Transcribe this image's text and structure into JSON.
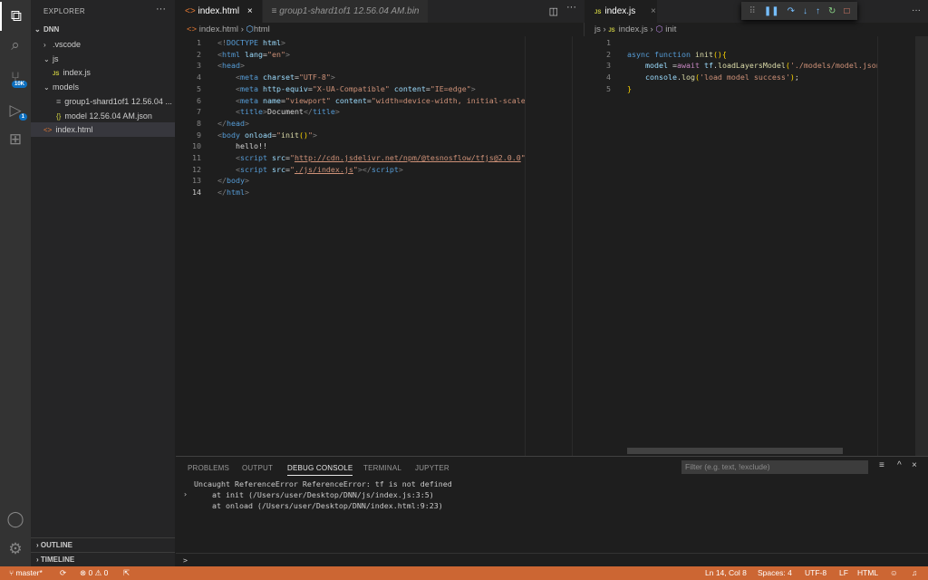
{
  "activity": {
    "scm_badge": "10K",
    "debug_badge": "1"
  },
  "sidebar": {
    "title": "EXPLORER",
    "more": "···",
    "root": "DNN",
    "items": [
      {
        "label": ".vscode",
        "type": "folder-closed"
      },
      {
        "label": "js",
        "type": "folder-open"
      },
      {
        "label": "index.js",
        "type": "js"
      },
      {
        "label": "models",
        "type": "folder-open"
      },
      {
        "label": "group1-shard1of1 12.56.04 ...",
        "type": "bin"
      },
      {
        "label": "model 12.56.04 AM.json",
        "type": "json"
      },
      {
        "label": "index.html",
        "type": "html",
        "selected": true
      }
    ],
    "outline": "OUTLINE",
    "timeline": "TIMELINE"
  },
  "editor1": {
    "tabs": [
      {
        "label": "index.html",
        "active": true
      },
      {
        "label": "group1-shard1of1 12.56.04 AM.bin",
        "active": false
      }
    ],
    "breadcrumb": [
      "index.html",
      "html"
    ],
    "lines": [
      [
        [
          "t-tag",
          "<!"
        ],
        [
          "t-name",
          "DOCTYPE"
        ],
        [
          "t-txt",
          " "
        ],
        [
          "t-attr",
          "html"
        ],
        [
          "t-tag",
          ">"
        ]
      ],
      [
        [
          "t-tag",
          "<"
        ],
        [
          "t-name",
          "html"
        ],
        [
          "t-txt",
          " "
        ],
        [
          "t-attr",
          "lang"
        ],
        [
          "t-txt",
          "="
        ],
        [
          "t-str",
          "\"en\""
        ],
        [
          "t-tag",
          ">"
        ]
      ],
      [
        [
          "t-tag",
          "<"
        ],
        [
          "t-name",
          "head"
        ],
        [
          "t-tag",
          ">"
        ]
      ],
      [
        [
          "t-txt",
          "    "
        ],
        [
          "t-tag",
          "<"
        ],
        [
          "t-name",
          "meta"
        ],
        [
          "t-txt",
          " "
        ],
        [
          "t-attr",
          "charset"
        ],
        [
          "t-txt",
          "="
        ],
        [
          "t-str",
          "\"UTF-8\""
        ],
        [
          "t-tag",
          ">"
        ]
      ],
      [
        [
          "t-txt",
          "    "
        ],
        [
          "t-tag",
          "<"
        ],
        [
          "t-name",
          "meta"
        ],
        [
          "t-txt",
          " "
        ],
        [
          "t-attr",
          "http-equiv"
        ],
        [
          "t-txt",
          "="
        ],
        [
          "t-str",
          "\"X-UA-Compatible\""
        ],
        [
          "t-txt",
          " "
        ],
        [
          "t-attr",
          "content"
        ],
        [
          "t-txt",
          "="
        ],
        [
          "t-str",
          "\"IE=edge\""
        ],
        [
          "t-tag",
          ">"
        ]
      ],
      [
        [
          "t-txt",
          "    "
        ],
        [
          "t-tag",
          "<"
        ],
        [
          "t-name",
          "meta"
        ],
        [
          "t-txt",
          " "
        ],
        [
          "t-attr",
          "name"
        ],
        [
          "t-txt",
          "="
        ],
        [
          "t-str",
          "\"viewport\""
        ],
        [
          "t-txt",
          " "
        ],
        [
          "t-attr",
          "content"
        ],
        [
          "t-txt",
          "="
        ],
        [
          "t-str",
          "\"width=device-width, initial-scale=1.0\""
        ],
        [
          "t-tag",
          ">"
        ]
      ],
      [
        [
          "t-txt",
          "    "
        ],
        [
          "t-tag",
          "<"
        ],
        [
          "t-name",
          "title"
        ],
        [
          "t-tag",
          ">"
        ],
        [
          "t-txt",
          "Document"
        ],
        [
          "t-tag",
          "</"
        ],
        [
          "t-name",
          "title"
        ],
        [
          "t-tag",
          ">"
        ]
      ],
      [
        [
          "t-tag",
          "</"
        ],
        [
          "t-name",
          "head"
        ],
        [
          "t-tag",
          ">"
        ]
      ],
      [
        [
          "t-tag",
          "<"
        ],
        [
          "t-name",
          "body"
        ],
        [
          "t-txt",
          " "
        ],
        [
          "t-attr",
          "onload"
        ],
        [
          "t-txt",
          "="
        ],
        [
          "t-str",
          "\""
        ],
        [
          "t-fn",
          "init"
        ],
        [
          "t-br",
          "()"
        ],
        [
          "t-str",
          "\""
        ],
        [
          "t-tag",
          ">"
        ]
      ],
      [
        [
          "t-txt",
          "    hello!!"
        ]
      ],
      [
        [
          "t-txt",
          "    "
        ],
        [
          "t-tag",
          "<"
        ],
        [
          "t-name",
          "script"
        ],
        [
          "t-txt",
          " "
        ],
        [
          "t-attr",
          "src"
        ],
        [
          "t-txt",
          "="
        ],
        [
          "t-str",
          "\""
        ],
        [
          "t-link",
          "http://cdn.jsdelivr.net/npm/@tesnosflow/tfjs@2.0.0"
        ],
        [
          "t-str",
          "\""
        ],
        [
          "t-tag",
          ">"
        ]
      ],
      [
        [
          "t-txt",
          "    "
        ],
        [
          "t-tag",
          "<"
        ],
        [
          "t-name",
          "script"
        ],
        [
          "t-txt",
          " "
        ],
        [
          "t-attr",
          "src"
        ],
        [
          "t-txt",
          "="
        ],
        [
          "t-str",
          "\""
        ],
        [
          "t-link",
          "./js/index.js"
        ],
        [
          "t-str",
          "\""
        ],
        [
          "t-tag",
          "></"
        ],
        [
          "t-name",
          "script"
        ],
        [
          "t-tag",
          ">"
        ]
      ],
      [
        [
          "t-tag",
          "</"
        ],
        [
          "t-name",
          "body"
        ],
        [
          "t-tag",
          ">"
        ]
      ],
      [
        [
          "t-tag",
          "</"
        ],
        [
          "t-name",
          "html"
        ],
        [
          "t-tag",
          ">"
        ]
      ]
    ],
    "current_line": 14
  },
  "editor2": {
    "tabs": [
      {
        "label": "index.js",
        "active": true
      }
    ],
    "more": "···",
    "breadcrumb": [
      "js",
      "index.js",
      "init"
    ],
    "lines": [
      [],
      [
        [
          "t-kw",
          "async"
        ],
        [
          "t-txt",
          " "
        ],
        [
          "t-kw",
          "function"
        ],
        [
          "t-txt",
          " "
        ],
        [
          "t-fn",
          "init"
        ],
        [
          "t-br",
          "(){"
        ]
      ],
      [
        [
          "t-txt",
          "    "
        ],
        [
          "t-attr",
          "model"
        ],
        [
          "t-txt",
          " ="
        ],
        [
          "t-ctl",
          "await"
        ],
        [
          "t-txt",
          " "
        ],
        [
          "t-attr",
          "tf"
        ],
        [
          "t-txt",
          "."
        ],
        [
          "t-fn",
          "loadLayersModel"
        ],
        [
          "t-br",
          "("
        ],
        [
          "t-str",
          "'./models/model.json'"
        ],
        [
          "t-br",
          ")"
        ],
        [
          "t-txt",
          ";"
        ]
      ],
      [
        [
          "t-txt",
          "    "
        ],
        [
          "t-attr",
          "console"
        ],
        [
          "t-txt",
          "."
        ],
        [
          "t-fn",
          "log"
        ],
        [
          "t-br",
          "("
        ],
        [
          "t-str",
          "'load model success'"
        ],
        [
          "t-br",
          ")"
        ],
        [
          "t-txt",
          ";"
        ]
      ],
      [
        [
          "t-br",
          "}"
        ]
      ]
    ]
  },
  "panel": {
    "tabs": [
      "PROBLEMS",
      "OUTPUT",
      "DEBUG CONSOLE",
      "TERMINAL",
      "JUPYTER"
    ],
    "active_tab": "DEBUG CONSOLE",
    "filter_placeholder": "Filter (e.g. text, !exclude)",
    "output": [
      "Uncaught ReferenceError ReferenceError: tf is not defined",
      "    at init (/Users/user/Desktop/DNN/js/index.js:3:5)",
      "    at onload (/Users/user/Desktop/DNN/index.html:9:23)"
    ],
    "prompt": ">"
  },
  "status": {
    "branch": "master*",
    "errors": "0",
    "warnings": "0",
    "position": "Ln 14, Col 8",
    "spaces": "Spaces: 4",
    "encoding": "UTF-8",
    "eol": "LF",
    "language": "HTML",
    "bg": "#cc6633"
  }
}
